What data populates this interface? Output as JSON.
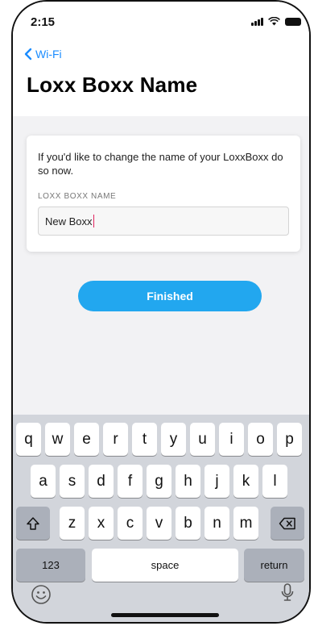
{
  "status_bar": {
    "time": "2:15",
    "icons": [
      "signal-icon",
      "wifi-icon",
      "battery-icon"
    ]
  },
  "nav": {
    "back_label": "Wi-Fi",
    "title": "Loxx Boxx Name"
  },
  "card": {
    "description": "If you'd like to change the name of your LoxxBoxx do so now.",
    "field_label": "LOXX BOXX NAME",
    "field_value": "New Boxx"
  },
  "finished_label": "Finished",
  "keyboard": {
    "row1": [
      "q",
      "w",
      "e",
      "r",
      "t",
      "y",
      "u",
      "i",
      "o",
      "p"
    ],
    "row2": [
      "a",
      "s",
      "d",
      "f",
      "g",
      "h",
      "j",
      "k",
      "l"
    ],
    "row3": [
      "z",
      "x",
      "c",
      "v",
      "b",
      "n",
      "m"
    ],
    "numbers_label": "123",
    "space_label": "space",
    "return_label": "return"
  },
  "colors": {
    "accent": "#1a8cff",
    "button": "#22a7ef",
    "keyboard_bg": "#d2d5db",
    "caret": "#e0245e"
  }
}
